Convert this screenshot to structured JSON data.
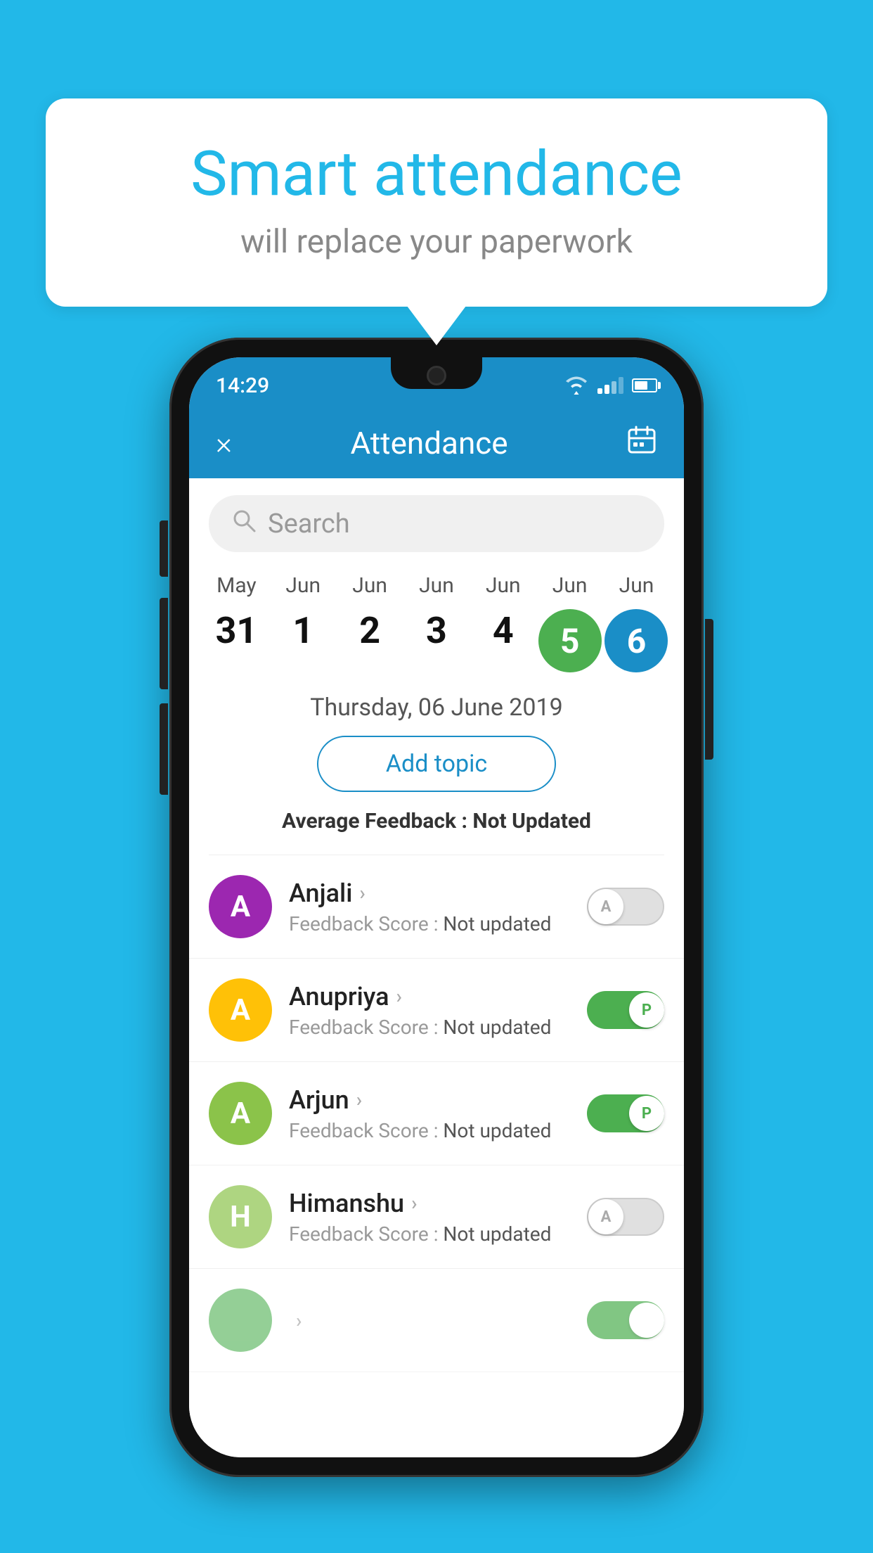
{
  "background_color": "#22b8e8",
  "speech_bubble": {
    "title": "Smart attendance",
    "subtitle": "will replace your paperwork"
  },
  "status_bar": {
    "time": "14:29"
  },
  "header": {
    "title": "Attendance",
    "close_label": "×",
    "calendar_label": "📅"
  },
  "search": {
    "placeholder": "Search"
  },
  "dates": [
    {
      "month": "May",
      "day": "31",
      "selected": false
    },
    {
      "month": "Jun",
      "day": "1",
      "selected": false
    },
    {
      "month": "Jun",
      "day": "2",
      "selected": false
    },
    {
      "month": "Jun",
      "day": "3",
      "selected": false
    },
    {
      "month": "Jun",
      "day": "4",
      "selected": false
    },
    {
      "month": "Jun",
      "day": "5",
      "selected": "green"
    },
    {
      "month": "Jun",
      "day": "6",
      "selected": "blue"
    }
  ],
  "selected_date": "Thursday, 06 June 2019",
  "add_topic_label": "Add topic",
  "feedback_summary": {
    "label": "Average Feedback : ",
    "value": "Not Updated"
  },
  "students": [
    {
      "name": "Anjali",
      "avatar_letter": "A",
      "avatar_color": "#9c27b0",
      "feedback_label": "Feedback Score : ",
      "feedback_value": "Not updated",
      "toggle_state": "off",
      "toggle_label": "A"
    },
    {
      "name": "Anupriya",
      "avatar_letter": "A",
      "avatar_color": "#ffc107",
      "feedback_label": "Feedback Score : ",
      "feedback_value": "Not updated",
      "toggle_state": "on",
      "toggle_label": "P"
    },
    {
      "name": "Arjun",
      "avatar_letter": "A",
      "avatar_color": "#8bc34a",
      "feedback_label": "Feedback Score : ",
      "feedback_value": "Not updated",
      "toggle_state": "on",
      "toggle_label": "P"
    },
    {
      "name": "Himanshu",
      "avatar_letter": "H",
      "avatar_color": "#aed581",
      "feedback_label": "Feedback Score : ",
      "feedback_value": "Not updated",
      "toggle_state": "off",
      "toggle_label": "A"
    }
  ]
}
